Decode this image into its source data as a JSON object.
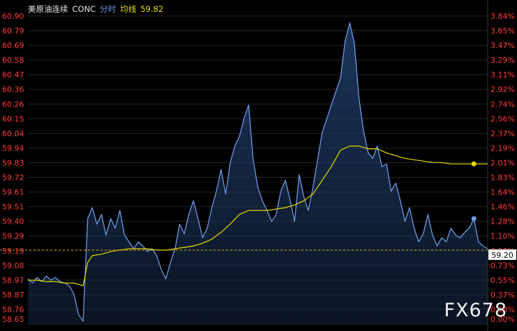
{
  "header": {
    "name": "美原油连续",
    "code": "CONC",
    "mode": "分时",
    "avg_label": "均线",
    "avg_value": "59.82"
  },
  "watermark": "FX678",
  "colors": {
    "background": "#000000",
    "price_line": "#6f9ae6",
    "price_fill_top": "#1e3a63",
    "avg_line": "#e6dc00",
    "axis_text": "#ff3b3b",
    "baseline": "#e0a000",
    "grid": "#272727",
    "label_bg": "#ffffff",
    "label_text": "#000000"
  },
  "chart_data": {
    "type": "line",
    "title": "美原油连续 CONC 分时",
    "ylim": [
      58.65,
      60.9
    ],
    "y_ticks_left": [
      "60.90",
      "60.79",
      "60.69",
      "60.58",
      "60.47",
      "60.36",
      "60.26",
      "60.15",
      "60.04",
      "59.94",
      "59.83",
      "59.72",
      "59.61",
      "59.51",
      "59.40",
      "59.29",
      "59.19",
      "59.08",
      "58.97",
      "58.87",
      "58.76",
      "58.65"
    ],
    "y_ticks_right": [
      "3.84%",
      "3.65%",
      "3.47%",
      "3.29%",
      "3.11%",
      "2.92%",
      "2.74%",
      "2.56%",
      "2.37%",
      "2.19%",
      "2.01%",
      "1.83%",
      "1.64%",
      "1.46%",
      "1.28%",
      "1.10%",
      "0.91%",
      "0.73%",
      "0.55%",
      "0.37%",
      "0.18%",
      "0.00%"
    ],
    "reference_price": 59.19,
    "current_price_label": "59.20",
    "x_range": [
      0,
      100
    ],
    "series": [
      {
        "x": [
          0,
          1,
          2,
          3,
          4,
          5,
          6,
          7,
          8,
          9,
          10,
          11,
          12,
          13,
          14,
          15,
          16,
          17,
          18,
          19,
          20,
          21,
          22,
          23,
          24,
          25,
          26,
          27,
          28,
          29,
          30,
          31,
          32,
          33,
          34,
          35,
          36,
          37,
          38,
          39,
          40,
          41,
          42,
          43,
          44,
          45,
          46,
          47,
          48,
          49,
          50,
          51,
          52,
          53,
          54,
          55,
          56,
          57,
          58,
          59,
          60,
          61,
          62,
          63,
          64,
          65,
          66,
          67,
          68,
          69,
          70,
          71,
          72,
          73,
          74,
          75,
          76,
          77,
          78,
          79,
          80,
          81,
          82,
          83,
          84,
          85,
          86,
          87,
          88,
          89,
          90,
          91,
          92,
          93,
          94,
          95,
          96,
          97,
          98,
          99,
          100
        ],
        "values": [
          58.98,
          58.95,
          58.99,
          58.96,
          59.0,
          58.97,
          58.99,
          58.96,
          58.95,
          58.93,
          58.87,
          58.72,
          58.67,
          59.42,
          59.5,
          59.38,
          59.45,
          59.3,
          59.42,
          59.35,
          59.48,
          59.3,
          59.25,
          59.2,
          59.25,
          59.22,
          59.18,
          59.2,
          59.15,
          59.05,
          58.98,
          59.1,
          59.2,
          59.38,
          59.31,
          59.45,
          59.55,
          59.42,
          59.28,
          59.35,
          59.5,
          59.62,
          59.78,
          59.6,
          59.83,
          59.95,
          60.02,
          60.15,
          60.25,
          59.85,
          59.65,
          59.55,
          59.48,
          59.4,
          59.45,
          59.62,
          59.7,
          59.56,
          59.4,
          59.74,
          59.58,
          59.48,
          59.65,
          59.85,
          60.05,
          60.15,
          60.25,
          60.35,
          60.45,
          60.72,
          60.85,
          60.7,
          60.3,
          60.06,
          59.9,
          59.86,
          59.95,
          59.8,
          59.82,
          59.62,
          59.68,
          59.55,
          59.4,
          59.5,
          59.35,
          59.25,
          59.31,
          59.45,
          59.3,
          59.22,
          59.28,
          59.25,
          59.35,
          59.3,
          59.28,
          59.32,
          59.35,
          59.42,
          59.25,
          59.22,
          59.2
        ]
      },
      {
        "x": [
          0,
          2,
          4,
          6,
          8,
          10,
          11,
          12,
          13,
          14,
          16,
          18,
          20,
          22,
          24,
          26,
          28,
          30,
          32,
          34,
          36,
          38,
          40,
          42,
          44,
          46,
          48,
          50,
          52,
          54,
          56,
          58,
          60,
          62,
          64,
          66,
          68,
          70,
          72,
          73,
          74,
          76,
          78,
          80,
          82,
          84,
          86,
          88,
          90,
          92,
          94,
          96,
          98,
          100
        ],
        "values": [
          58.97,
          58.97,
          58.96,
          58.96,
          58.95,
          58.95,
          58.94,
          58.93,
          59.1,
          59.15,
          59.16,
          59.18,
          59.19,
          59.2,
          59.2,
          59.2,
          59.19,
          59.19,
          59.2,
          59.21,
          59.22,
          59.24,
          59.27,
          59.32,
          59.38,
          59.45,
          59.48,
          59.48,
          59.48,
          59.49,
          59.5,
          59.52,
          59.55,
          59.6,
          59.7,
          59.8,
          59.92,
          59.95,
          59.95,
          59.94,
          59.93,
          59.93,
          59.9,
          59.88,
          59.86,
          59.85,
          59.84,
          59.83,
          59.83,
          59.82,
          59.82,
          59.82,
          59.82,
          59.82
        ]
      }
    ]
  }
}
